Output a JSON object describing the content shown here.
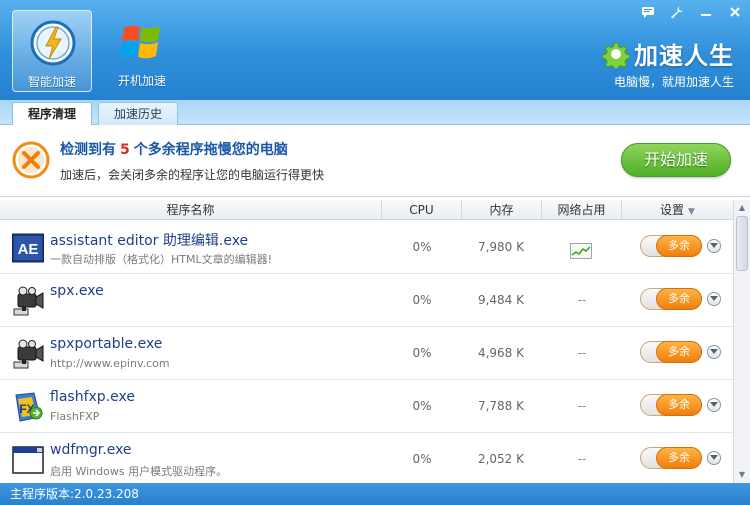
{
  "window": {
    "controls": [
      {
        "name": "feedback-icon",
        "glyph": "▣"
      },
      {
        "name": "settings-wrench-icon",
        "glyph": "🔧"
      },
      {
        "name": "minimize-icon",
        "glyph": "—"
      },
      {
        "name": "close-icon",
        "glyph": "✕"
      }
    ]
  },
  "toolbar": {
    "smart_accel": "智能加速",
    "boot_accel": "开机加速"
  },
  "brand": {
    "title": "加速人生",
    "subtitle": "电脑慢，就用加速人生"
  },
  "tabs": [
    {
      "label": "程序清理",
      "active": true
    },
    {
      "label": "加速历史",
      "active": false
    }
  ],
  "banner": {
    "title_prefix": "检测到有",
    "count": "5",
    "title_suffix": "个多余程序拖慢您的电脑",
    "subtitle": "加速后，会关闭多余的程序让您的电脑运行得更快",
    "start_button": "开始加速"
  },
  "table": {
    "columns": {
      "name": "程序名称",
      "cpu": "CPU",
      "mem": "内存",
      "net": "网络占用",
      "settings": "设置"
    },
    "rows": [
      {
        "icon": "ae-icon",
        "name": "assistant editor 助理编辑.exe",
        "desc": "一款自动排版（格式化）HTML文章的编辑器!",
        "cpu": "0%",
        "mem": "7,980 K",
        "net": "",
        "net_graph": true,
        "toggle": "多余"
      },
      {
        "icon": "spx-camera-icon",
        "name": "spx.exe",
        "desc": "",
        "cpu": "0%",
        "mem": "9,484 K",
        "net": "--",
        "net_graph": false,
        "toggle": "多余"
      },
      {
        "icon": "spx-camera-icon",
        "name": "spxportable.exe",
        "desc": "http://www.epinv.com",
        "cpu": "0%",
        "mem": "4,968 K",
        "net": "--",
        "net_graph": false,
        "toggle": "多余"
      },
      {
        "icon": "flashfxp-icon",
        "name": "flashfxp.exe",
        "desc": "FlashFXP",
        "cpu": "0%",
        "mem": "7,788 K",
        "net": "--",
        "net_graph": false,
        "toggle": "多余"
      },
      {
        "icon": "window-app-icon",
        "name": "wdfmgr.exe",
        "desc": "启用 Windows 用户模式驱动程序。",
        "cpu": "0%",
        "mem": "2,052 K",
        "net": "--",
        "net_graph": false,
        "toggle": "多余"
      }
    ]
  },
  "statusbar": {
    "version": "主程序版本:2.0.23.208"
  },
  "colors": {
    "header_blue": "#2f8fdb",
    "accent_green": "#4fae27",
    "toggle_orange": "#f07e0c",
    "count_red": "#e0281e"
  }
}
